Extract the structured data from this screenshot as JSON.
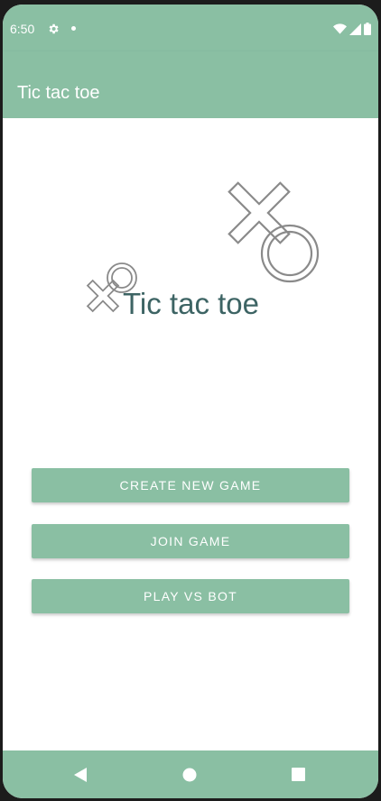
{
  "status_bar": {
    "time": "6:50",
    "icons": [
      "gear-icon",
      "notification-dot-icon",
      "wifi-icon",
      "signal-icon",
      "battery-icon"
    ]
  },
  "app_bar": {
    "title": "Tic tac toe"
  },
  "main": {
    "logo_text": "Tic tac toe",
    "buttons": [
      {
        "label": "CREATE NEW GAME"
      },
      {
        "label": "JOIN GAME"
      },
      {
        "label": "PLAY VS BOT"
      }
    ]
  },
  "nav_bar": {
    "icons": [
      "back-icon",
      "home-icon",
      "recents-icon"
    ]
  },
  "colors": {
    "primary": "#8abfa3",
    "logo_text": "#3d6464",
    "background": "#ffffff"
  }
}
